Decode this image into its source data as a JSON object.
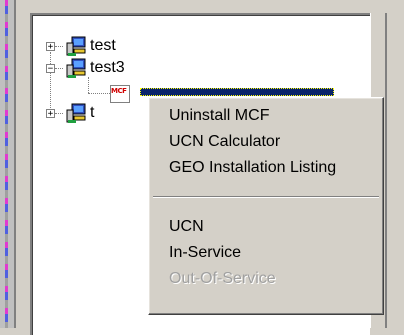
{
  "tree": {
    "nodes": [
      {
        "label": "test",
        "expander": "+"
      },
      {
        "label": "test3",
        "expander": "−"
      },
      {
        "label": "t",
        "expander": "+"
      }
    ],
    "child_icon_text": "MCF"
  },
  "context_menu": {
    "items": [
      {
        "label": "Uninstall  MCF",
        "enabled": true
      },
      {
        "label": "UCN Calculator",
        "enabled": true
      },
      {
        "label": "GEO Installation Listing",
        "enabled": true
      },
      {
        "label": "UCN",
        "enabled": true
      },
      {
        "label": "In-Service",
        "enabled": true
      },
      {
        "label": "Out-Of-Service",
        "enabled": false
      }
    ]
  },
  "colors": {
    "window_face": "#d4d0c8",
    "tree_bg": "#ffffff",
    "selection": "#0a246a",
    "disabled_text": "#a0a0a0"
  },
  "icons": [
    "plus-expander-icon",
    "minus-expander-icon",
    "computer-icon",
    "mcf-file-icon"
  ]
}
